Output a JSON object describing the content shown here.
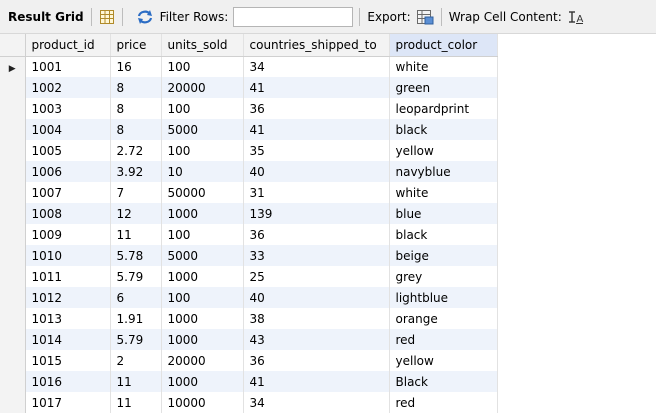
{
  "toolbar": {
    "title": "Result Grid",
    "filter_label": "Filter Rows:",
    "filter_value": "",
    "export_label": "Export:",
    "wrap_label": "Wrap Cell Content:",
    "icons": [
      "grid-icon",
      "refresh-icon",
      "export-icon",
      "wrap-icon"
    ]
  },
  "grid": {
    "columns": [
      "product_id",
      "price",
      "units_sold",
      "countries_shipped_to",
      "product_color"
    ],
    "sorted_column": "product_color",
    "current_row_marker": "▶",
    "rows": [
      [
        "1001",
        "16",
        "100",
        "34",
        "white"
      ],
      [
        "1002",
        "8",
        "20000",
        "41",
        "green"
      ],
      [
        "1003",
        "8",
        "100",
        "36",
        "leopardprint"
      ],
      [
        "1004",
        "8",
        "5000",
        "41",
        "black"
      ],
      [
        "1005",
        "2.72",
        "100",
        "35",
        "yellow"
      ],
      [
        "1006",
        "3.92",
        "10",
        "40",
        "navyblue"
      ],
      [
        "1007",
        "7",
        "50000",
        "31",
        "white"
      ],
      [
        "1008",
        "12",
        "1000",
        "139",
        "blue"
      ],
      [
        "1009",
        "11",
        "100",
        "36",
        "black"
      ],
      [
        "1010",
        "5.78",
        "5000",
        "33",
        "beige"
      ],
      [
        "1011",
        "5.79",
        "1000",
        "25",
        "grey"
      ],
      [
        "1012",
        "6",
        "100",
        "40",
        "lightblue"
      ],
      [
        "1013",
        "1.91",
        "1000",
        "38",
        "orange"
      ],
      [
        "1014",
        "5.79",
        "1000",
        "43",
        "red"
      ],
      [
        "1015",
        "2",
        "20000",
        "36",
        "yellow"
      ],
      [
        "1016",
        "11",
        "1000",
        "41",
        "Black"
      ],
      [
        "1017",
        "11",
        "10000",
        "34",
        "red"
      ]
    ]
  },
  "colors": {
    "alt_row": "#eef3fb",
    "sorted_header": "#dde6f7",
    "refresh_icon": "#2b6cc4"
  }
}
